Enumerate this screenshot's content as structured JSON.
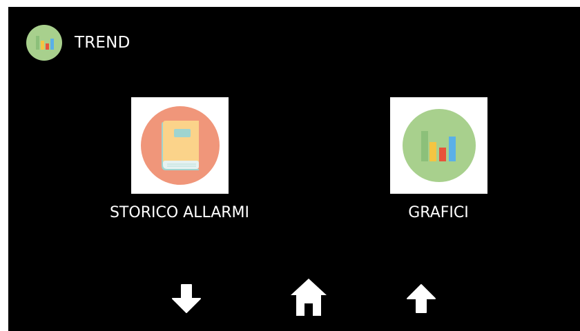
{
  "header": {
    "title": "TREND",
    "icon": "bar-chart-icon",
    "icon_bg": "#a8d08d"
  },
  "tiles": [
    {
      "label": "STORICO ALLARMI",
      "icon": "book-icon",
      "circle_color": "#f0967a"
    },
    {
      "label": "GRAFICI",
      "icon": "bar-chart-icon",
      "circle_color": "#a8d08d"
    }
  ],
  "nav": {
    "down_icon": "arrow-down-icon",
    "home_icon": "home-icon",
    "up_icon": "arrow-up-icon"
  },
  "colors": {
    "background": "#000000",
    "text": "#ffffff",
    "tile_bg": "#ffffff"
  }
}
